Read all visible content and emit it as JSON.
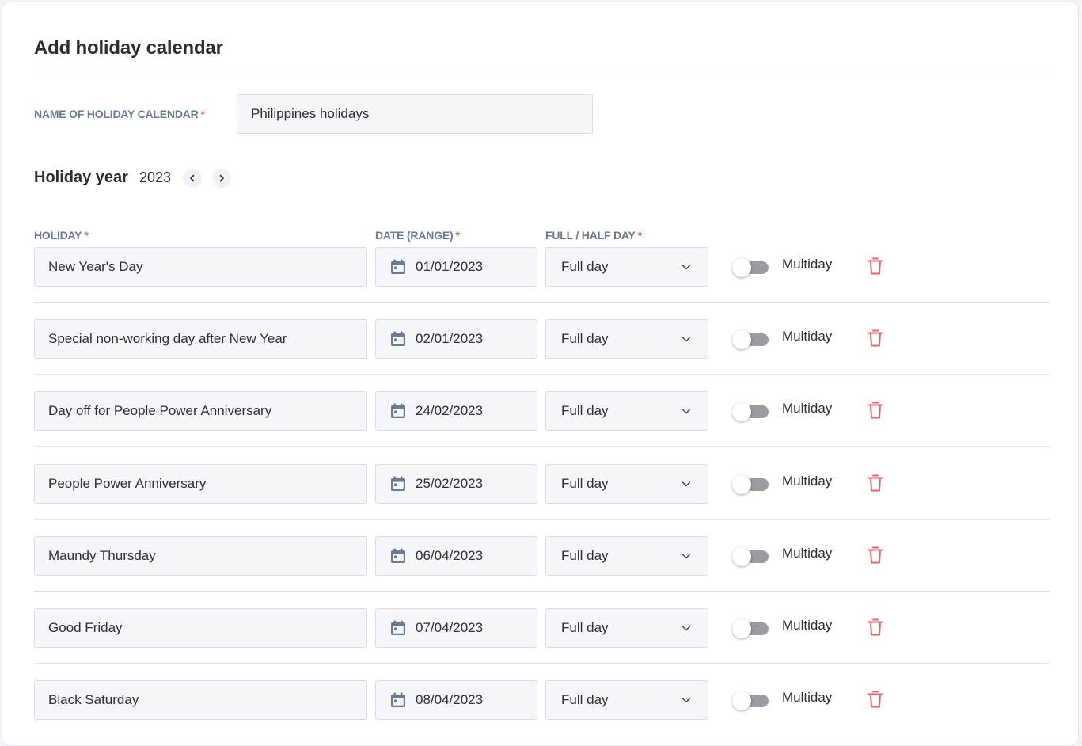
{
  "page": {
    "title": "Add holiday calendar"
  },
  "calendar_name": {
    "label": "NAME OF HOLIDAY CALENDAR",
    "required_mark": "*",
    "value": "Philippines holidays"
  },
  "holiday_year": {
    "label": "Holiday year",
    "value": "2023",
    "prev_icon": "chevron-left-icon",
    "next_icon": "chevron-right-icon"
  },
  "columns": {
    "holiday": "HOLIDAY",
    "date": "DATE (RANGE)",
    "day_type": "FULL / HALF DAY",
    "required_mark": "*"
  },
  "rows": [
    {
      "holiday": "New Year's Day",
      "date": "01/01/2023",
      "day_type": "Full day",
      "multiday_label": "Multiday",
      "multiday": false
    },
    {
      "holiday": "Special non-working day after New Year",
      "date": "02/01/2023",
      "day_type": "Full day",
      "multiday_label": "Multiday",
      "multiday": false
    },
    {
      "holiday": "Day off for People Power Anniversary",
      "date": "24/02/2023",
      "day_type": "Full day",
      "multiday_label": "Multiday",
      "multiday": false
    },
    {
      "holiday": "People Power Anniversary",
      "date": "25/02/2023",
      "day_type": "Full day",
      "multiday_label": "Multiday",
      "multiday": false
    },
    {
      "holiday": "Maundy Thursday",
      "date": "06/04/2023",
      "day_type": "Full day",
      "multiday_label": "Multiday",
      "multiday": false
    },
    {
      "holiday": "Good Friday",
      "date": "07/04/2023",
      "day_type": "Full day",
      "multiday_label": "Multiday",
      "multiday": false
    },
    {
      "holiday": "Black Saturday",
      "date": "08/04/2023",
      "day_type": "Full day",
      "multiday_label": "Multiday",
      "multiday": false
    }
  ],
  "icons": {
    "date": "calendar-icon",
    "select": "chevron-down-icon",
    "delete": "trash-icon"
  },
  "colors": {
    "label": "#6a7a90",
    "required": "#e8636b",
    "delete": "#e8636b",
    "toggle_off": "#9a9ca1",
    "icon": "#6b7a90"
  }
}
